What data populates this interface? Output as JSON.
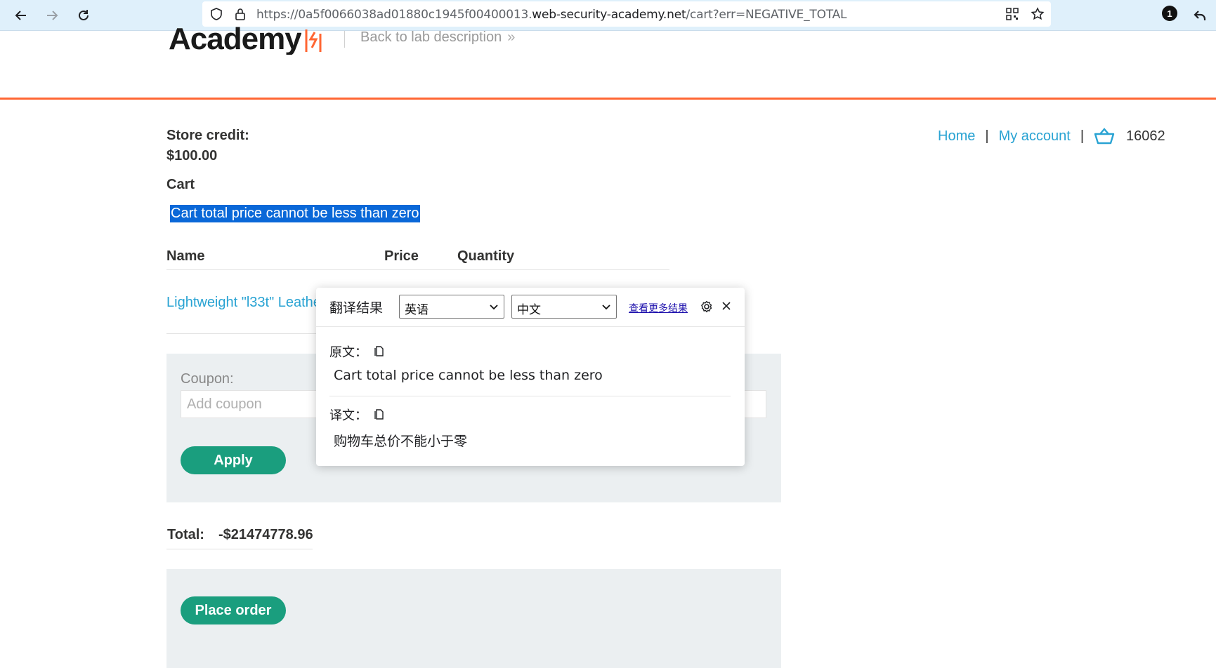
{
  "browser": {
    "url_prefix": "https://0a5f0066038ad01880c1945f00400013.",
    "url_domain": "web-security-academy.net",
    "url_path": "/cart?err=NEGATIVE_TOTAL",
    "extension_badge": "1"
  },
  "header": {
    "logo_text": "Academy",
    "back_link": "Back to lab description",
    "back_chevron": "»"
  },
  "nav": {
    "home": "Home",
    "separator": "|",
    "my_account": "My account",
    "cart_count": "16062"
  },
  "account": {
    "store_credit_label": "Store credit:",
    "store_credit_value": "$100.00"
  },
  "cart": {
    "heading": "Cart",
    "error_message": "Cart total price cannot be less than zero",
    "columns": [
      "Name",
      "Price",
      "Quantity"
    ],
    "rows": [
      {
        "name": "Lightweight \"l33t\" Leather Jacket"
      }
    ]
  },
  "coupon": {
    "label": "Coupon:",
    "placeholder": "Add coupon",
    "apply_label": "Apply"
  },
  "totals": {
    "label": "Total:",
    "value": "-$21474778.96"
  },
  "order": {
    "place_order_label": "Place order"
  },
  "translate_popup": {
    "title": "翻译结果",
    "source_lang": "英语",
    "target_lang": "中文",
    "more_results": "查看更多结果",
    "original_label": "原文：",
    "original_text": "Cart total price cannot be less than zero",
    "translation_label": "译文：",
    "translation_text": "购物车总价不能小于零"
  },
  "colors": {
    "accent_orange": "#ff6633",
    "link_blue": "#29a3d3",
    "button_green": "#1a9e7e",
    "panel_gray": "#ebeff1",
    "selection_blue": "#0a68d8"
  }
}
